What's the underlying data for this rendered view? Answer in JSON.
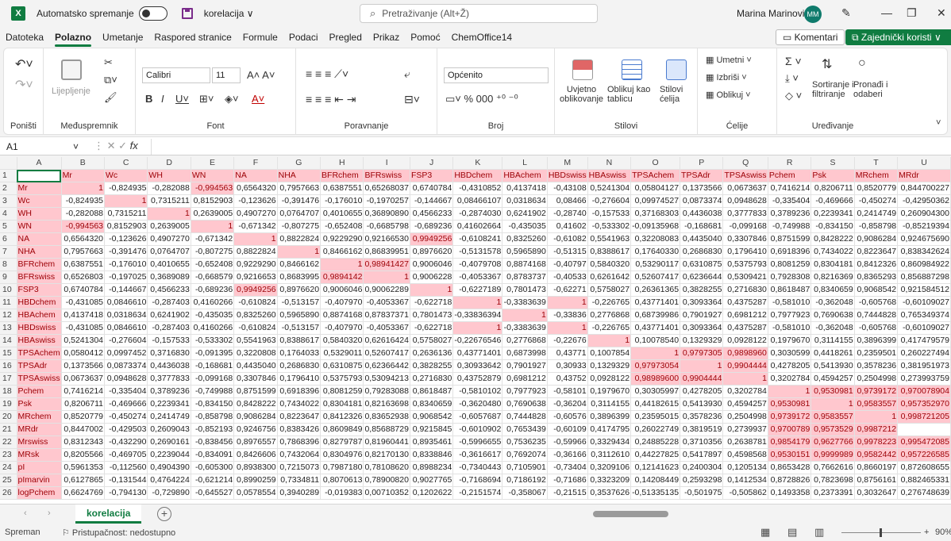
{
  "title": {
    "autosave": "Automatsko spremanje",
    "doc": "korelacija ∨",
    "search": "Pretraživanje (Alt+Ž)",
    "user": "Marina Marinović",
    "initials": "MM"
  },
  "menu": [
    "Datoteka",
    "Polazno",
    "Umetanje",
    "Raspored stranice",
    "Formule",
    "Podaci",
    "Pregled",
    "Prikaz",
    "Pomoć",
    "ChemOffice14"
  ],
  "menu_active": "Polazno",
  "comments": "Komentari",
  "share": "Zajednički koristi",
  "ribbon": {
    "undo_group": "Poništi",
    "clipboard": {
      "paste": "Lijepljenje",
      "label": "Međuspremnik"
    },
    "font": {
      "name": "Calibri",
      "size": "11",
      "label": "Font"
    },
    "alignment": {
      "label": "Poravnanje"
    },
    "number": {
      "format": "Općenito",
      "label": "Broj"
    },
    "styles": {
      "cond": "Uvjetno\noblikovanje",
      "table": "Oblikuj kao\ntablicu",
      "cell": "Stilovi\nćelija",
      "label": "Stilovi"
    },
    "cells": {
      "insert": "Umetni",
      "delete": "Izbriši",
      "format": "Oblikuj",
      "label": "Ćelije"
    },
    "editing": {
      "sort": "Sortiranje i\nfiltriranje",
      "find": "Pronađi i\nodaberi",
      "label": "Uređivanje"
    }
  },
  "namebox": "A1",
  "columns": [
    "A",
    "B",
    "C",
    "D",
    "E",
    "F",
    "G",
    "H",
    "I",
    "J",
    "K",
    "L",
    "M",
    "N",
    "O",
    "P",
    "Q",
    "R",
    "S",
    "T",
    "U"
  ],
  "header_row": [
    "",
    "Mr",
    "Wc",
    "WH",
    "WN",
    "NA",
    "NHA",
    "BFRchem",
    "BFRswiss",
    "FSP3",
    "HBDchem",
    "HBAchem",
    "HBDswiss",
    "HBAswiss",
    "TPSAchem",
    "TPSAdr",
    "TPSAswiss",
    "Pchem",
    "Psk",
    "MRchem",
    "MRdr"
  ],
  "rows": [
    [
      "Mr",
      "1",
      "-0,824935",
      "-0,282088",
      "-0,994563",
      "0,6564320",
      "0,7957663",
      "0,6387551",
      "0,65268037",
      "0,6740784",
      "-0,4310852",
      "0,4137418",
      "-0,43108",
      "0,5241304",
      "0,05804127",
      "0,1373566",
      "0,0673637",
      "0,7416214",
      "0,8206711",
      "0,8520779",
      "0,844700227"
    ],
    [
      "Wc",
      "-0,824935",
      "1",
      "0,7315211",
      "0,8152903",
      "-0,123626",
      "-0,391476",
      "-0,176010",
      "-0,1970257",
      "-0,144667",
      "0,08466107",
      "0,0318634",
      "0,08466",
      "-0,276604",
      "0,09974527",
      "0,0873374",
      "0,0948628",
      "-0,335404",
      "-0,469666",
      "-0,450274",
      "-0,42950362"
    ],
    [
      "WH",
      "-0,282088",
      "0,7315211",
      "1",
      "0,2639005",
      "0,4907270",
      "0,0764707",
      "0,4010655",
      "0,36890890",
      "0,4566233",
      "-0,2874030",
      "0,6241902",
      "-0,28740",
      "-0,157533",
      "0,37168303",
      "0,4436038",
      "0,3777833",
      "0,3789236",
      "0,2239341",
      "0,2414749",
      "0,260904300"
    ],
    [
      "WN",
      "-0,994563",
      "0,8152903",
      "0,2639005",
      "1",
      "-0,671342",
      "-0,807275",
      "-0,652408",
      "-0,6685798",
      "-0,689236",
      "0,41602664",
      "-0,435035",
      "0,41602",
      "-0,533302",
      "-0,09135968",
      "-0,168681",
      "-0,099168",
      "-0,749988",
      "-0,834150",
      "-0,858798",
      "-0,85219394"
    ],
    [
      "NA",
      "0,6564320",
      "-0,123626",
      "0,4907270",
      "-0,671342",
      "1",
      "0,8822824",
      "0,9229290",
      "0,92166530",
      "0,9949256",
      "-0,6108241",
      "0,8325260",
      "-0,61082",
      "0,5541963",
      "0,32208083",
      "0,4435040",
      "0,3307846",
      "0,8751599",
      "0,8428222",
      "0,9086284",
      "0,924675690"
    ],
    [
      "NHA",
      "0,7957663",
      "-0,391476",
      "0,0764707",
      "-0,807275",
      "0,8822824",
      "1",
      "0,8466162",
      "0,86839951",
      "0,8976620",
      "-0,5131578",
      "0,5965890",
      "-0,51315",
      "0,8388617",
      "0,17640330",
      "0,2686830",
      "0,1796410",
      "0,6918396",
      "0,7434022",
      "0,8223647",
      "0,838342624"
    ],
    [
      "BFRchem",
      "0,6387551",
      "-0,176010",
      "0,4010655",
      "-0,652408",
      "0,9229290",
      "0,8466162",
      "1",
      "0,98941427",
      "0,9006046",
      "-0,4079708",
      "0,8874168",
      "-0,40797",
      "0,5840320",
      "0,53290117",
      "0,6310875",
      "0,5375793",
      "0,8081259",
      "0,8304181",
      "0,8412326",
      "0,860984922"
    ],
    [
      "BFRswiss",
      "0,6526803",
      "-0,197025",
      "0,3689089",
      "-0,668579",
      "0,9216653",
      "0,8683995",
      "0,9894142",
      "1",
      "0,9006228",
      "-0,4053367",
      "0,8783737",
      "-0,40533",
      "0,6261642",
      "0,52607417",
      "0,6236644",
      "0,5309421",
      "0,7928308",
      "0,8216369",
      "0,8365293",
      "0,856887298"
    ],
    [
      "FSP3",
      "0,6740784",
      "-0,144667",
      "0,4566233",
      "-0,689236",
      "0,9949256",
      "0,8976620",
      "0,9006046",
      "0,90062289",
      "1",
      "-0,6227189",
      "0,7801473",
      "-0,62271",
      "0,5758027",
      "0,26361365",
      "0,3828255",
      "0,2716830",
      "0,8618487",
      "0,8340659",
      "0,9068542",
      "0,921584512"
    ],
    [
      "HBDchem",
      "-0,431085",
      "0,0846610",
      "-0,287403",
      "0,4160266",
      "-0,610824",
      "-0,513157",
      "-0,407970",
      "-0,4053367",
      "-0,622718",
      "1",
      "-0,3383639",
      "1",
      "-0,226765",
      "0,43771401",
      "0,3093364",
      "0,4375287",
      "-0,581010",
      "-0,362048",
      "-0,605768",
      "-0,60109027"
    ],
    [
      "HBAchem",
      "0,4137418",
      "0,0318634",
      "0,6241902",
      "-0,435035",
      "0,8325260",
      "0,5965890",
      "0,8874168",
      "0,87837371",
      "0,7801473",
      "-0,33836394",
      "1",
      "-0,33836",
      "0,2776868",
      "0,68739986",
      "0,7901927",
      "0,6981212",
      "0,7977923",
      "0,7690638",
      "0,7444828",
      "0,765349374"
    ],
    [
      "HBDswiss",
      "-0,431085",
      "0,0846610",
      "-0,287403",
      "0,4160266",
      "-0,610824",
      "-0,513157",
      "-0,407970",
      "-0,4053367",
      "-0,622718",
      "1",
      "-0,3383639",
      "1",
      "-0,226765",
      "0,43771401",
      "0,3093364",
      "0,4375287",
      "-0,581010",
      "-0,362048",
      "-0,605768",
      "-0,60109027"
    ],
    [
      "HBAswiss",
      "0,5241304",
      "-0,276604",
      "-0,157533",
      "-0,533302",
      "0,5541963",
      "0,8388617",
      "0,5840320",
      "0,62616424",
      "0,5758027",
      "-0,22676546",
      "0,2776868",
      "-0,22676",
      "1",
      "0,10078540",
      "0,1329329",
      "0,0928122",
      "0,1979670",
      "0,3114155",
      "0,3896399",
      "0,417479579"
    ],
    [
      "TPSAchem",
      "0,0580412",
      "0,0997452",
      "0,3716830",
      "-0,091395",
      "0,3220808",
      "0,1764033",
      "0,5329011",
      "0,52607417",
      "0,2636136",
      "0,43771401",
      "0,6873998",
      "0,43771",
      "0,1007854",
      "1",
      "0,9797305",
      "0,9898960",
      "0,3030599",
      "0,4418261",
      "0,2359501",
      "0,260227494"
    ],
    [
      "TPSAdr",
      "0,1373566",
      "0,0873374",
      "0,4436038",
      "-0,168681",
      "0,4435040",
      "0,2686830",
      "0,6310875",
      "0,62366442",
      "0,3828255",
      "0,30933642",
      "0,7901927",
      "0,30933",
      "0,1329329",
      "0,97973054",
      "1",
      "0,9904444",
      "0,4278205",
      "0,5413930",
      "0,3578236",
      "0,381951973"
    ],
    [
      "TPSAswiss",
      "0,0673637",
      "0,0948628",
      "0,3777833",
      "-0,099168",
      "0,3307846",
      "0,1796410",
      "0,5375793",
      "0,53094213",
      "0,2716830",
      "0,43752879",
      "0,6981212",
      "0,43752",
      "0,0928122",
      "0,98989600",
      "0,9904444",
      "1",
      "0,3202784",
      "0,4594257",
      "0,2504998",
      "0,273993759"
    ],
    [
      "Pchem",
      "0,7416214",
      "-0,335404",
      "0,3789236",
      "-0,749988",
      "0,8751599",
      "0,6918396",
      "0,8081259",
      "0,79283088",
      "0,8618487",
      "-0,5810102",
      "0,7977923",
      "-0,58101",
      "0,1979670",
      "0,30305997",
      "0,4278205",
      "0,3202784",
      "1",
      "0,9530981",
      "0,9739172",
      "0,970078904"
    ],
    [
      "Psk",
      "0,8206711",
      "-0,469666",
      "0,2239341",
      "-0,834150",
      "0,8428222",
      "0,7434022",
      "0,8304181",
      "0,82163698",
      "0,8340659",
      "-0,3620480",
      "0,7690638",
      "-0,36204",
      "0,3114155",
      "0,44182615",
      "0,5413930",
      "0,4594257",
      "0,9530981",
      "1",
      "0,9583557",
      "0,957352970"
    ],
    [
      "MRchem",
      "0,8520779",
      "-0,450274",
      "0,2414749",
      "-0,858798",
      "0,9086284",
      "0,8223647",
      "0,8412326",
      "0,83652938",
      "0,9068542",
      "-0,6057687",
      "0,7444828",
      "-0,60576",
      "0,3896399",
      "0,23595015",
      "0,3578236",
      "0,2504998",
      "0,9739172",
      "0,9583557",
      "1",
      "0,998721205"
    ],
    [
      "MRdr",
      "0,8447002",
      "-0,429503",
      "0,2609043",
      "-0,852193",
      "0,9246756",
      "0,8383426",
      "0,8609849",
      "0,85688729",
      "0,9215845",
      "-0,6010902",
      "0,7653439",
      "-0,60109",
      "0,4174795",
      "0,26022749",
      "0,3819519",
      "0,2739937",
      "0,9700789",
      "0,9573529",
      "0,9987212",
      ""
    ],
    [
      "Mrswiss",
      "0,8312343",
      "-0,432290",
      "0,2690161",
      "-0,838456",
      "0,8976557",
      "0,7868396",
      "0,8279787",
      "0,81960441",
      "0,8935461",
      "-0,5996655",
      "0,7536235",
      "-0,59966",
      "0,3329434",
      "0,24885228",
      "0,3710356",
      "0,2638781",
      "0,9854179",
      "0,9627766",
      "0,9978223",
      "0,995472085"
    ],
    [
      "MRsk",
      "0,8205566",
      "-0,469705",
      "0,2239044",
      "-0,834091",
      "0,8426606",
      "0,7432064",
      "0,8304976",
      "0,82170130",
      "0,8338846",
      "-0,3616617",
      "0,7692074",
      "-0,36166",
      "0,3112610",
      "0,44227825",
      "0,5417897",
      "0,4598568",
      "0,9530151",
      "0,9999989",
      "0,9582442",
      "0,957226585"
    ],
    [
      "pI",
      "0,5961353",
      "-0,112560",
      "0,4904390",
      "-0,605300",
      "0,8938300",
      "0,7215073",
      "0,7987180",
      "0,78108620",
      "0,8988234",
      "-0,7340443",
      "0,7105901",
      "-0,73404",
      "0,3209106",
      "0,12141623",
      "0,2400304",
      "0,1205134",
      "0,8653428",
      "0,7662616",
      "0,8660197",
      "0,872608655"
    ],
    [
      "pImarvin",
      "0,6127865",
      "-0,131544",
      "0,4764224",
      "-0,621214",
      "0,8990259",
      "0,7334811",
      "0,8070613",
      "0,78900820",
      "0,9027765",
      "-0,7168694",
      "0,7186192",
      "-0,71686",
      "0,3323209",
      "0,14208449",
      "0,2593298",
      "0,1412534",
      "0,8728826",
      "0,7823698",
      "0,8756161",
      "0,882465331"
    ],
    [
      "logPchem",
      "0,6624769",
      "-0,794130",
      "-0,729890",
      "-0,645527",
      "0,0578554",
      "0,3940289",
      "-0,019383",
      "0,00710352",
      "0,1202622",
      "-0,2151574",
      "-0,358067",
      "-0,21515",
      "0,3537626",
      "-0,51335135",
      "-0,501975",
      "-0,505862",
      "0,1493358",
      "0,2373391",
      "0,3032647",
      "0,276748639"
    ]
  ],
  "sheet_tab": "korelacija",
  "status": {
    "mode": "Spreman",
    "accessibility": "Pristupačnost: nedostupno",
    "zoom": "90%"
  }
}
